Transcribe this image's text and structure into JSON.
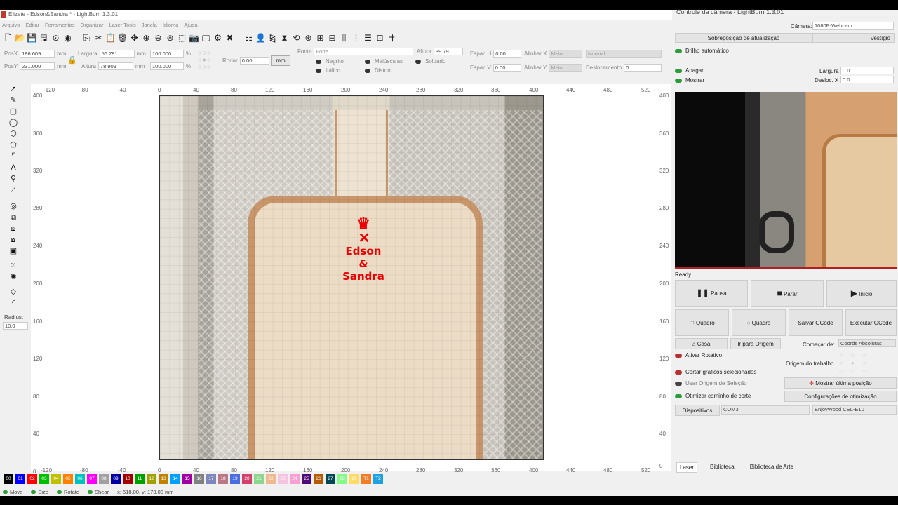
{
  "window": {
    "title": "Elizete - Edson&Sandra * - LightBurn 1.3.01"
  },
  "menu": [
    "Arquivo",
    "Editar",
    "Ferramentas",
    "Organizar",
    "Laser Tools",
    "Janela",
    "Idioma",
    "Ajuda"
  ],
  "props": {
    "posx_label": "PosX",
    "posx": "186.609",
    "posy_label": "PosY",
    "posy": "231.000",
    "unit": "mm",
    "largura_label": "Largura",
    "largura": "56.781",
    "altura_label": "Altura",
    "altura": "78.909",
    "scale_w": "100.000",
    "scale_h": "100.000",
    "pct": "%",
    "rodar_label": "Rodar",
    "rodar": "0.00",
    "mm_btn": "mm",
    "fonte_label": "Fonte",
    "fonte": "Forte",
    "font_altura_label": "Altura",
    "font_altura": "39.79",
    "negrito": "Negrito",
    "italico": "Itálico",
    "maiusculas": "Maiúsculas",
    "distort": "Distort",
    "soldado": "Soldado",
    "espac_h_label": "Espac.H",
    "espac_h": "0.00",
    "espac_v_label": "Espac.V",
    "espac_v": "0.00",
    "alinhar_x_label": "Alinhar X",
    "alinhar_x": "Meio",
    "alinhar_y_label": "Alinhar Y",
    "alinhar_y": "Meio",
    "normal": "Normal",
    "deslocamento_label": "Deslocamento",
    "deslocamento": "0"
  },
  "ruler": {
    "top": [
      "-120",
      "-80",
      "-40",
      "0",
      "40",
      "80",
      "120",
      "160",
      "200",
      "240",
      "280",
      "320",
      "360",
      "400",
      "440",
      "480",
      "520"
    ],
    "left": [
      "400",
      "360",
      "320",
      "280",
      "240",
      "200",
      "160",
      "120",
      "80",
      "40",
      "0"
    ],
    "right": [
      "400",
      "360",
      "320",
      "280",
      "240",
      "200",
      "160",
      "120",
      "80",
      "40",
      "0"
    ]
  },
  "engraving": {
    "line1": "Edson",
    "line2": "&",
    "line3": "Sandra"
  },
  "radius": {
    "label": "Radius:",
    "value": "10.0"
  },
  "swatches": [
    {
      "l": "00",
      "c": "#000000"
    },
    {
      "l": "01",
      "c": "#0000ff"
    },
    {
      "l": "02",
      "c": "#ff0000"
    },
    {
      "l": "03",
      "c": "#00c000"
    },
    {
      "l": "04",
      "c": "#c0c000"
    },
    {
      "l": "05",
      "c": "#ff8000"
    },
    {
      "l": "06",
      "c": "#00c0c0"
    },
    {
      "l": "07",
      "c": "#ff00ff"
    },
    {
      "l": "08",
      "c": "#a0a0a0"
    },
    {
      "l": "09",
      "c": "#0000a0"
    },
    {
      "l": "10",
      "c": "#a00000"
    },
    {
      "l": "11",
      "c": "#00a000"
    },
    {
      "l": "12",
      "c": "#a0a000"
    },
    {
      "l": "13",
      "c": "#c08000"
    },
    {
      "l": "14",
      "c": "#00a0ff"
    },
    {
      "l": "15",
      "c": "#a000a0"
    },
    {
      "l": "16",
      "c": "#808080"
    },
    {
      "l": "17",
      "c": "#7d87b9"
    },
    {
      "l": "18",
      "c": "#bb7784"
    },
    {
      "l": "19",
      "c": "#4a6fe3"
    },
    {
      "l": "20",
      "c": "#d33f6a"
    },
    {
      "l": "21",
      "c": "#8cd78c"
    },
    {
      "l": "22",
      "c": "#f0b98d"
    },
    {
      "l": "23",
      "c": "#f6c4e1"
    },
    {
      "l": "24",
      "c": "#fa9ed4"
    },
    {
      "l": "25",
      "c": "#500a78"
    },
    {
      "l": "26",
      "c": "#b45a00"
    },
    {
      "l": "27",
      "c": "#004754"
    },
    {
      "l": "28",
      "c": "#86fa88"
    },
    {
      "l": "29",
      "c": "#ffdb66"
    },
    {
      "l": "T1",
      "c": "#f37c24"
    },
    {
      "l": "T2",
      "c": "#1fa0e0"
    }
  ],
  "status": {
    "move": "Move",
    "size": "Size",
    "rotate": "Rotate",
    "shear": "Shear",
    "coords": "x: 518.00, y: 173.00 mm"
  },
  "camera": {
    "title": "Controle da câmera - LightBurn 1.3.01",
    "camera_label": "Câmera:",
    "camera_value": "1080P-Webcam",
    "overlay_btn": "Sobreposição de atualização",
    "vestigio_btn": "Vestígio",
    "brilho": "Brilho automático",
    "apagar": "Apagar",
    "mostrar": "Mostrar",
    "largura_label": "Largura",
    "largura": "0.0",
    "desloc_label": "Desloc. X",
    "desloc": "0.0"
  },
  "laser": {
    "status": "Ready",
    "pausa": "Pausa",
    "parar": "Parar",
    "inicio": "Início",
    "quadro1": "Quadro",
    "quadro2": "Quadro",
    "salvar": "Salvar GCode",
    "executar": "Executar GCode",
    "casa": "Casa",
    "ir_origem": "Ir para Origem",
    "comecar_label": "Começar de:",
    "comecar": "Coords Absolutas",
    "rotativo": "Ativar Rotativo",
    "origem_trabalho": "Origem do trabalho",
    "cortar_sel": "Cortar gráficos selecionados",
    "usar_origem": "Usar Origem de Seleção",
    "mostrar_pos": "Mostrar última posição",
    "otimizar": "Otimizar caminho de corte",
    "config_otim": "Configurações de otimização",
    "dispositivos": "Dispositivos",
    "porta": "COM3",
    "maquina": "EnjoyWood CEL-E10"
  },
  "tabs": [
    "Laser",
    "Biblioteca",
    "Biblioteca de Arte"
  ]
}
